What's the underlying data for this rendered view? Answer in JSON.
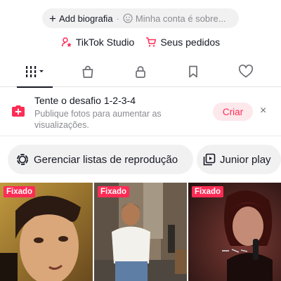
{
  "bio": {
    "add_label": "Add biografia",
    "separator": "·",
    "placeholder": "Minha conta é sobre..."
  },
  "links": {
    "studio": "TikTok Studio",
    "orders": "Seus pedidos"
  },
  "tabs": [
    {
      "icon": "videos-grid-icon",
      "active": true
    },
    {
      "icon": "shop-bag-icon",
      "active": false
    },
    {
      "icon": "lock-icon",
      "active": false
    },
    {
      "icon": "bookmark-icon",
      "active": false
    },
    {
      "icon": "heart-icon",
      "active": false
    }
  ],
  "challenge": {
    "title": "Tente o desafio 1-2-3-4",
    "description": "Publique fotos para aumentar as visualizações.",
    "button": "Criar",
    "close": "×"
  },
  "chips": {
    "playlists": "Gerenciar listas de reprodução",
    "junior": "Junior play"
  },
  "videos": [
    {
      "badge": "Fixado"
    },
    {
      "badge": "Fixado"
    },
    {
      "badge": "Fixado"
    }
  ],
  "colors": {
    "accent": "#fe2c55",
    "text": "#161823",
    "muted": "#8a8b91",
    "chip_bg": "#f1f1f2"
  }
}
